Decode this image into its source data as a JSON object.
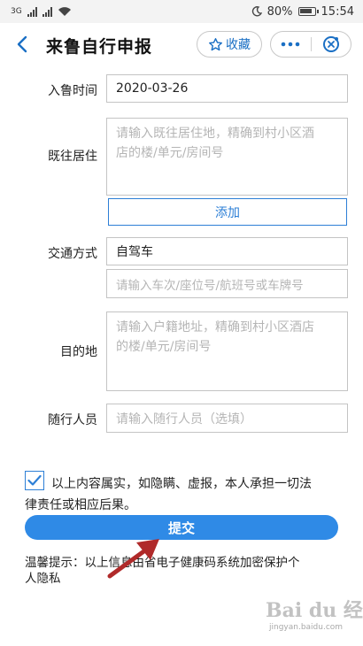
{
  "status_bar": {
    "network_left": "3G",
    "battery": "80%",
    "time": "15:54"
  },
  "header": {
    "title": "来鲁自行申报",
    "favorite_label": "收藏",
    "icons": [
      "chevron-left-icon",
      "star-icon",
      "more-icon",
      "close-circle-icon"
    ]
  },
  "form": {
    "arrival_time": {
      "label": "入鲁时间",
      "value": "2020-03-26"
    },
    "previous_residence": {
      "label": "既往居住",
      "placeholder_line1": "请输入既往居住地，精确到村小区酒",
      "placeholder_line2": "店的楼/单元/房间号",
      "add_label": "添加"
    },
    "transport": {
      "label": "交通方式",
      "value": "自驾车",
      "detail_placeholder": "请输入车次/座位号/航班号或车牌号"
    },
    "destination": {
      "label": "目的地",
      "placeholder_line1": "请输入户籍地址，精确到村小区酒店",
      "placeholder_line2": "的楼/单元/房间号"
    },
    "companions": {
      "label": "随行人员",
      "placeholder": "请输入随行人员（选填）"
    }
  },
  "agreement": {
    "checked": true,
    "line1": "以上内容属实，如隐瞒、虚报，本人承担一切法",
    "line2": "律责任或相应后果。"
  },
  "submit_label": "提交",
  "hint": {
    "line1": "温馨提示：以上信息由省电子健康码系统加密保护个",
    "line2": "人隐私"
  },
  "watermark": {
    "brand": "Bai du 经验",
    "url": "jingyan.baidu.com"
  },
  "colors": {
    "accent": "#2f8ae6",
    "border": "#c4c4c4",
    "placeholder": "#b5b5b5",
    "annotation_arrow": "#b02a2a"
  }
}
